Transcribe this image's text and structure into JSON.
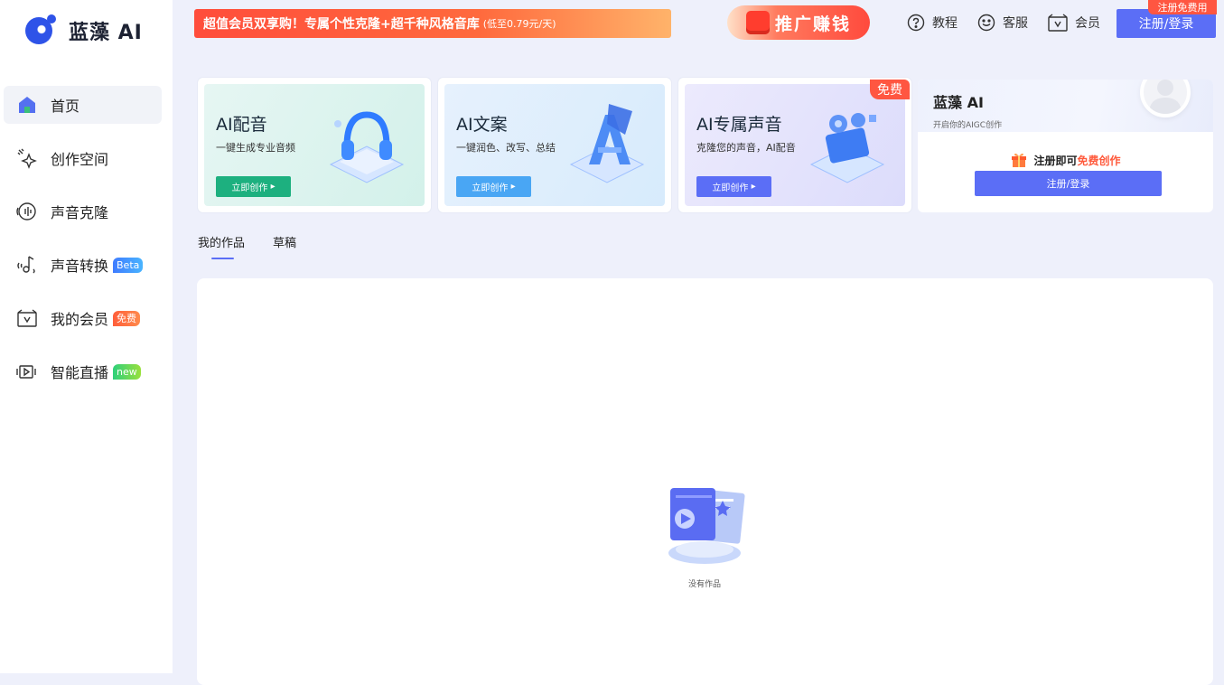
{
  "app": {
    "name": "蓝藻 AI"
  },
  "sidebar": {
    "items": [
      {
        "label": "首页",
        "icon": "home-icon",
        "badge": ""
      },
      {
        "label": "创作空间",
        "icon": "sparkle-icon",
        "badge": ""
      },
      {
        "label": "声音克隆",
        "icon": "voice-clone-icon",
        "badge": ""
      },
      {
        "label": "声音转换",
        "icon": "voice-convert-icon",
        "badge": "Beta"
      },
      {
        "label": "我的会员",
        "icon": "vip-icon",
        "badge": "免费"
      },
      {
        "label": "智能直播",
        "icon": "live-icon",
        "badge": "new"
      }
    ]
  },
  "header": {
    "banner": "超值会员双享购！专属个性克隆+超千种风格音库",
    "banner_small": "(低至0.79元/天)",
    "promo": "推广赚钱",
    "tutorial": "教程",
    "service": "客服",
    "member": "会员",
    "login": "注册/登录",
    "login_ribbon": "注册免费用"
  },
  "cards": [
    {
      "title": "AI配音",
      "desc": "一键生成专业音频",
      "cta": "立即创作",
      "color": "#1db07f"
    },
    {
      "title": "AI文案",
      "desc": "一键润色、改写、总结",
      "cta": "立即创作",
      "color": "#49a6f4"
    },
    {
      "title": "AI专属声音",
      "desc": "克隆您的声音，AI配音",
      "cta": "立即创作",
      "color": "#5b6ef6",
      "tag": "免费"
    }
  ],
  "user_card": {
    "name": "蓝藻 AI",
    "subtitle": "开启你的AIGC创作",
    "promo_prefix": "注册即可",
    "promo_highlight": "免费创作",
    "login": "注册/登录"
  },
  "tabs": [
    "我的作品",
    "草稿"
  ],
  "works": {
    "empty_text": "没有作品"
  },
  "colors": {
    "accent": "#5b6ef6",
    "red": "#ff5641",
    "green": "#1db07f",
    "blue": "#49a6f4"
  }
}
